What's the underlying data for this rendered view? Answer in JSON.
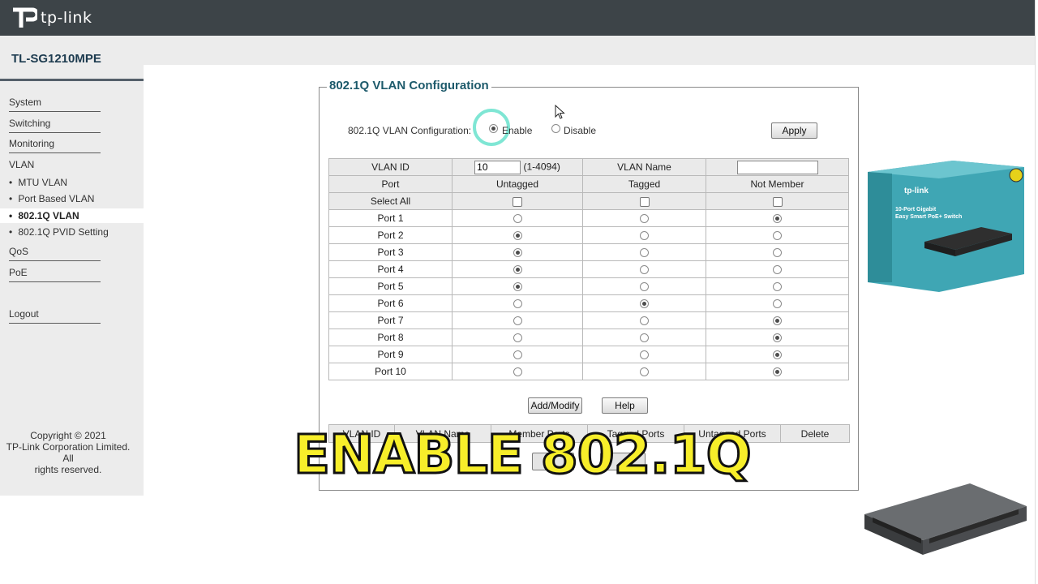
{
  "brand": {
    "logo_text": "tp-link"
  },
  "model": "TL-SG1210MPE",
  "sidebar": {
    "items": [
      "System",
      "Switching",
      "Monitoring",
      "VLAN"
    ],
    "vlan_sub": [
      "MTU VLAN",
      "Port Based VLAN",
      "802.1Q VLAN",
      "802.1Q PVID Setting"
    ],
    "items_after": [
      "QoS",
      "PoE"
    ],
    "logout": "Logout",
    "active": "802.1Q VLAN"
  },
  "copyright": {
    "line1": "Copyright © 2021",
    "line2": "TP-Link Corporation Limited. All",
    "line3": "rights reserved."
  },
  "config": {
    "section_title": "802.1Q VLAN Configuration",
    "label": "802.1Q VLAN Configuration:",
    "enable_label": "Enable",
    "disable_label": "Disable",
    "selected": "Enable",
    "apply": "Apply"
  },
  "vlan_form": {
    "vlan_id_label": "VLAN ID",
    "vlan_id_value": "10",
    "vlan_id_range": "(1-4094)",
    "vlan_name_label": "VLAN Name",
    "vlan_name_value": "",
    "columns": [
      "Port",
      "Untagged",
      "Tagged",
      "Not Member"
    ],
    "select_all": "Select All",
    "ports": [
      {
        "name": "Port 1",
        "mode": "not_member"
      },
      {
        "name": "Port 2",
        "mode": "untagged"
      },
      {
        "name": "Port 3",
        "mode": "untagged"
      },
      {
        "name": "Port 4",
        "mode": "untagged"
      },
      {
        "name": "Port 5",
        "mode": "untagged"
      },
      {
        "name": "Port 6",
        "mode": "tagged"
      },
      {
        "name": "Port 7",
        "mode": "not_member"
      },
      {
        "name": "Port 8",
        "mode": "not_member"
      },
      {
        "name": "Port 9",
        "mode": "not_member"
      },
      {
        "name": "Port 10",
        "mode": "not_member"
      }
    ],
    "add_modify": "Add/Modify",
    "help": "Help"
  },
  "vlan_list": {
    "columns": [
      "VLAN ID",
      "VLAN Name",
      "Member Ports",
      "Tagged Ports",
      "Untagged Ports",
      "Delete"
    ]
  },
  "caption": "ENABLE 802.1Q",
  "product": {
    "box_brand": "tp-link",
    "box_line1": "10-Port Gigabit",
    "box_line2": "Easy Smart PoE+ Switch",
    "colors": {
      "box_teal": "#3fa6b4",
      "caption_yellow": "#f7ee2a",
      "topbar": "#3d4448"
    }
  }
}
